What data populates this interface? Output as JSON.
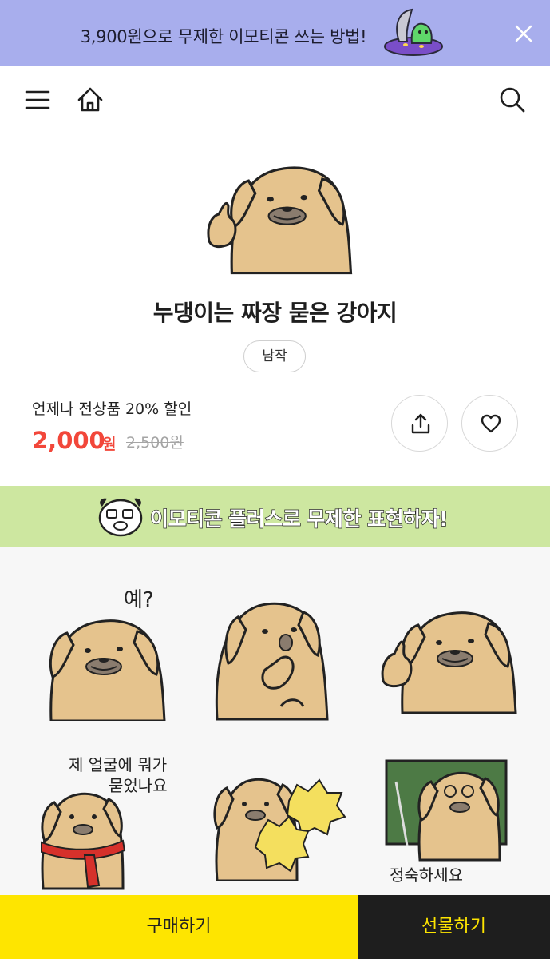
{
  "promo": {
    "text": "3,900원으로 무제한 이모티콘 쓰는 방법!"
  },
  "product": {
    "title": "누댕이는 짜장 묻은 강아지",
    "artist": "남작",
    "discount_text": "언제나 전상품 20% 할인",
    "price": "2,000",
    "price_unit": "원",
    "original_price": "2,500원"
  },
  "plus_banner": {
    "text": "이모티콘 플러스로 무제한 표현하자!"
  },
  "previews": {
    "captions": {
      "yes": "예?",
      "face_line1": "제 얼굴에 뭐가",
      "face_line2": "묻었나요",
      "silence": "정숙하세요"
    }
  },
  "bottom_bar": {
    "buy_label": "구매하기",
    "gift_label": "선물하기"
  },
  "colors": {
    "promo_bg": "#a8aeed",
    "plus_bg": "#cde7a0",
    "price": "#f2473a",
    "buy_bg": "#fee500",
    "gift_bg": "#1e1e1e",
    "dog_fur": "#e5c38d"
  }
}
